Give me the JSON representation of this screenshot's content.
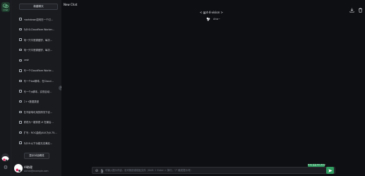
{
  "rail": {
    "brand_caption": "Chat",
    "brand_icon": "chat-brand-icon",
    "settings_icon": "gear-icon"
  },
  "sidebar": {
    "new_chat_label": "新建聊天",
    "conversations": [
      {
        "label": "markdown如何在一个引…"
      },
      {
        "label": "为什么Cloudflare Worker…"
      },
      {
        "label": "用一只平底锅做饼，每次…"
      },
      {
        "label": "用一只平底锅做饼，每次…"
      },
      {
        "label": "cesh"
      },
      {
        "label": "写一个Cloudflare Worke…"
      },
      {
        "label": "写一个bat脚本，在Cloud…"
      },
      {
        "label": "写一个js脚本，实现自动…"
      },
      {
        "label": "C++数据类型"
      },
      {
        "label": "在不影响可用的情况下优…"
      },
      {
        "label": "修改为一键到底 # 在最后…"
      },
      {
        "label": "扩写：ROC曲线(AUC为0.75…"
      },
      {
        "label": "为什么以下功能无法满足…"
      }
    ],
    "summary_label": "显示对话概览",
    "settings_icon": "gear-icon",
    "collapse_glyph": "‹"
  },
  "user": {
    "name": "AI助理",
    "email": "aichat@example.com"
  },
  "main": {
    "title": "New Chat",
    "model_label": "< gpt-4-vision >",
    "assistant_name": "Aha~",
    "hint_badge": "Enter 发送 Ctrl+Enter",
    "input_placeholder": "可输入提示内容，也可拖放或粘贴文件（Shift + Enter = 换行，\"/\" 触发提示词）"
  },
  "colors": {
    "accent": "#2f9b5f",
    "background": "#0e0f12",
    "sidebar": "#1a1b1f"
  }
}
